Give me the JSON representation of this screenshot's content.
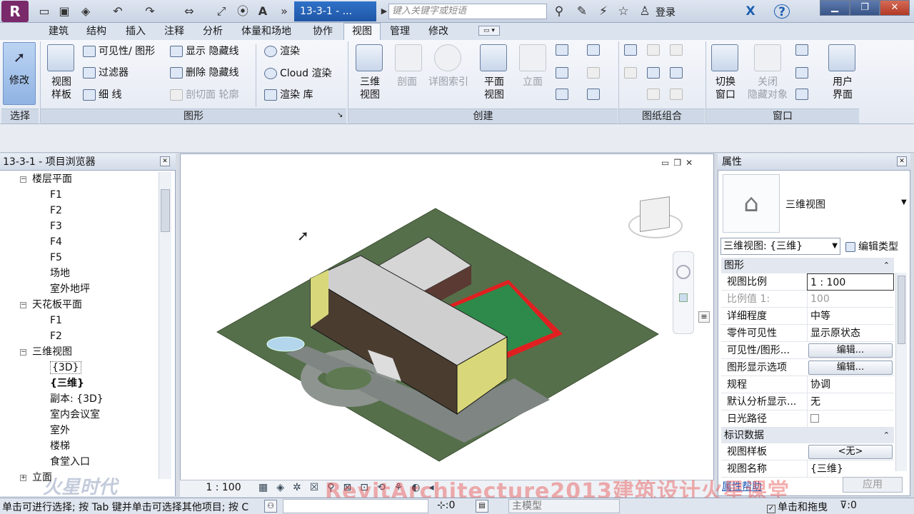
{
  "titlebar": {
    "app_logo": "R",
    "doc_tab": "13-3-1 - ...",
    "search_placeholder": "键入关键字或短语",
    "login": "登录"
  },
  "ribbon_tabs": [
    "建筑",
    "结构",
    "插入",
    "注释",
    "分析",
    "体量和场地",
    "协作",
    "视图",
    "管理",
    "修改"
  ],
  "active_tab": "视图",
  "ribbon": {
    "select": {
      "modify": "修改",
      "panel": "选择"
    },
    "graphics": {
      "view_template": "视图\n样板",
      "visibility": "可见性/ 图形",
      "filters": "过滤器",
      "thin_lines": "细 线",
      "show_hidden": "显示 隐藏线",
      "remove_hidden": "删除 隐藏线",
      "cut_profile": "剖切面 轮廓",
      "render": "渲染",
      "cloud_render": "Cloud  渲染",
      "render_gallery": "渲染  库",
      "panel": "图形"
    },
    "create": {
      "threed": "三维\n视图",
      "section": "剖面",
      "callout": "详图索引",
      "plan": "平面\n视图",
      "elevation": "立面",
      "panel": "创建"
    },
    "sheet_panel": "图纸组合",
    "windows": {
      "switch": "切换\n窗口",
      "close_hidden": "关闭\n隐藏对象",
      "ui": "用户\n界面",
      "panel": "窗口"
    }
  },
  "browser": {
    "title": "13-3-1 - 项目浏览器",
    "items": [
      {
        "label": "楼层平面",
        "level": 1,
        "exp": "−"
      },
      {
        "label": "F1",
        "level": 2
      },
      {
        "label": "F2",
        "level": 2
      },
      {
        "label": "F3",
        "level": 2
      },
      {
        "label": "F4",
        "level": 2
      },
      {
        "label": "F5",
        "level": 2
      },
      {
        "label": "场地",
        "level": 2
      },
      {
        "label": "室外地坪",
        "level": 2
      },
      {
        "label": "天花板平面",
        "level": 1,
        "exp": "−"
      },
      {
        "label": "F1",
        "level": 2
      },
      {
        "label": "F2",
        "level": 2
      },
      {
        "label": "三维视图",
        "level": 1,
        "exp": "−"
      },
      {
        "label": "{3D}",
        "level": 2
      },
      {
        "label": "{三维}",
        "level": 2,
        "bold": true
      },
      {
        "label": "副本: {3D}",
        "level": 2
      },
      {
        "label": "室内会议室",
        "level": 2
      },
      {
        "label": "室外",
        "level": 2
      },
      {
        "label": "楼梯",
        "level": 2
      },
      {
        "label": "食堂入口",
        "level": 2
      },
      {
        "label": "立面",
        "level": 1,
        "exp": "+"
      }
    ]
  },
  "view_status": {
    "scale": "1 : 100"
  },
  "properties": {
    "title": "属性",
    "type_name": "三维视图",
    "selector": "三维视图: {三维}",
    "edit_type": "编辑类型",
    "groups": [
      {
        "label": "图形",
        "rows": [
          {
            "name": "视图比例",
            "value": "1 : 100",
            "kind": "input"
          },
          {
            "name": "比例值 1:",
            "value": "100",
            "kind": "dim"
          },
          {
            "name": "详细程度",
            "value": "中等"
          },
          {
            "name": "零件可见性",
            "value": "显示原状态"
          },
          {
            "name": "可见性/图形...",
            "value": "编辑...",
            "kind": "button"
          },
          {
            "name": "图形显示选项",
            "value": "编辑...",
            "kind": "button"
          },
          {
            "name": "规程",
            "value": "协调"
          },
          {
            "name": "默认分析显示...",
            "value": "无"
          },
          {
            "name": "日光路径",
            "value": "",
            "kind": "check"
          }
        ]
      },
      {
        "label": "标识数据",
        "rows": [
          {
            "name": "视图样板",
            "value": "<无>",
            "kind": "button"
          },
          {
            "name": "视图名称",
            "value": "{三维}"
          }
        ]
      }
    ],
    "help": "属性帮助",
    "apply": "应用"
  },
  "status": {
    "message": "单击可进行选择; 按 Tab 键并单击可选择其他项目; 按 C",
    "count": ":0",
    "model": "主模型",
    "drag": "单击和拖曳",
    "filter": ":0"
  },
  "watermark": "RevitArchitecture2013建筑设计火星课堂",
  "logo_watermark": "火星时代"
}
